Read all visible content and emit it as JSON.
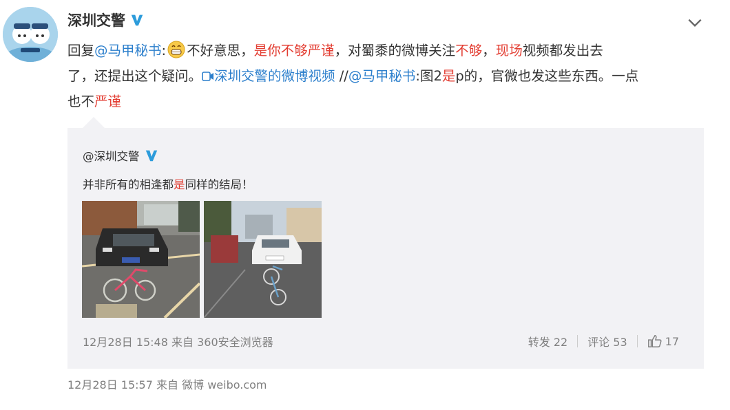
{
  "post": {
    "author": "深圳交警",
    "content": {
      "reply_prefix": "回复",
      "mention1": "@马甲秘书",
      "colon": ":",
      "t1": "不好意思，",
      "t2": "是你不够严谨",
      "t3": "，对蜀黍的微博关注",
      "t4": "不够",
      "t5": "，",
      "t6": "现场",
      "t7": "视频都发出去",
      "t8": "了，还提出这个疑问。",
      "video_link": "深圳交警的微博视频",
      "t9": " //",
      "mention2": "@马甲秘书",
      "t10": ":图2",
      "t11": "是",
      "t12": "p的，官微也发这些东西。一点",
      "t13": "也不",
      "t14": "严谨"
    },
    "meta": {
      "date": "12月28日 15:57",
      "from_label": "来自",
      "source": "微博 weibo.com"
    }
  },
  "quoted": {
    "author": "@深圳交警",
    "text_a": "并非所有的相逢都",
    "text_b": "是",
    "text_c": "同样的结局！",
    "meta": {
      "date": "12月28日 15:48",
      "from_label": "来自",
      "source": "360安全浏览器"
    },
    "actions": {
      "repost": "转发 22",
      "comment": "评论 53",
      "like": "17"
    }
  },
  "colors": {
    "highlight": "#e33e33",
    "link": "#2c7fcc",
    "verified": "#2d9cdb",
    "quote_bg": "#f2f2f5"
  },
  "icons": [
    "avatar",
    "verified-icon",
    "chevron-down-icon",
    "grin-emoji-icon",
    "video-icon",
    "like-icon"
  ]
}
